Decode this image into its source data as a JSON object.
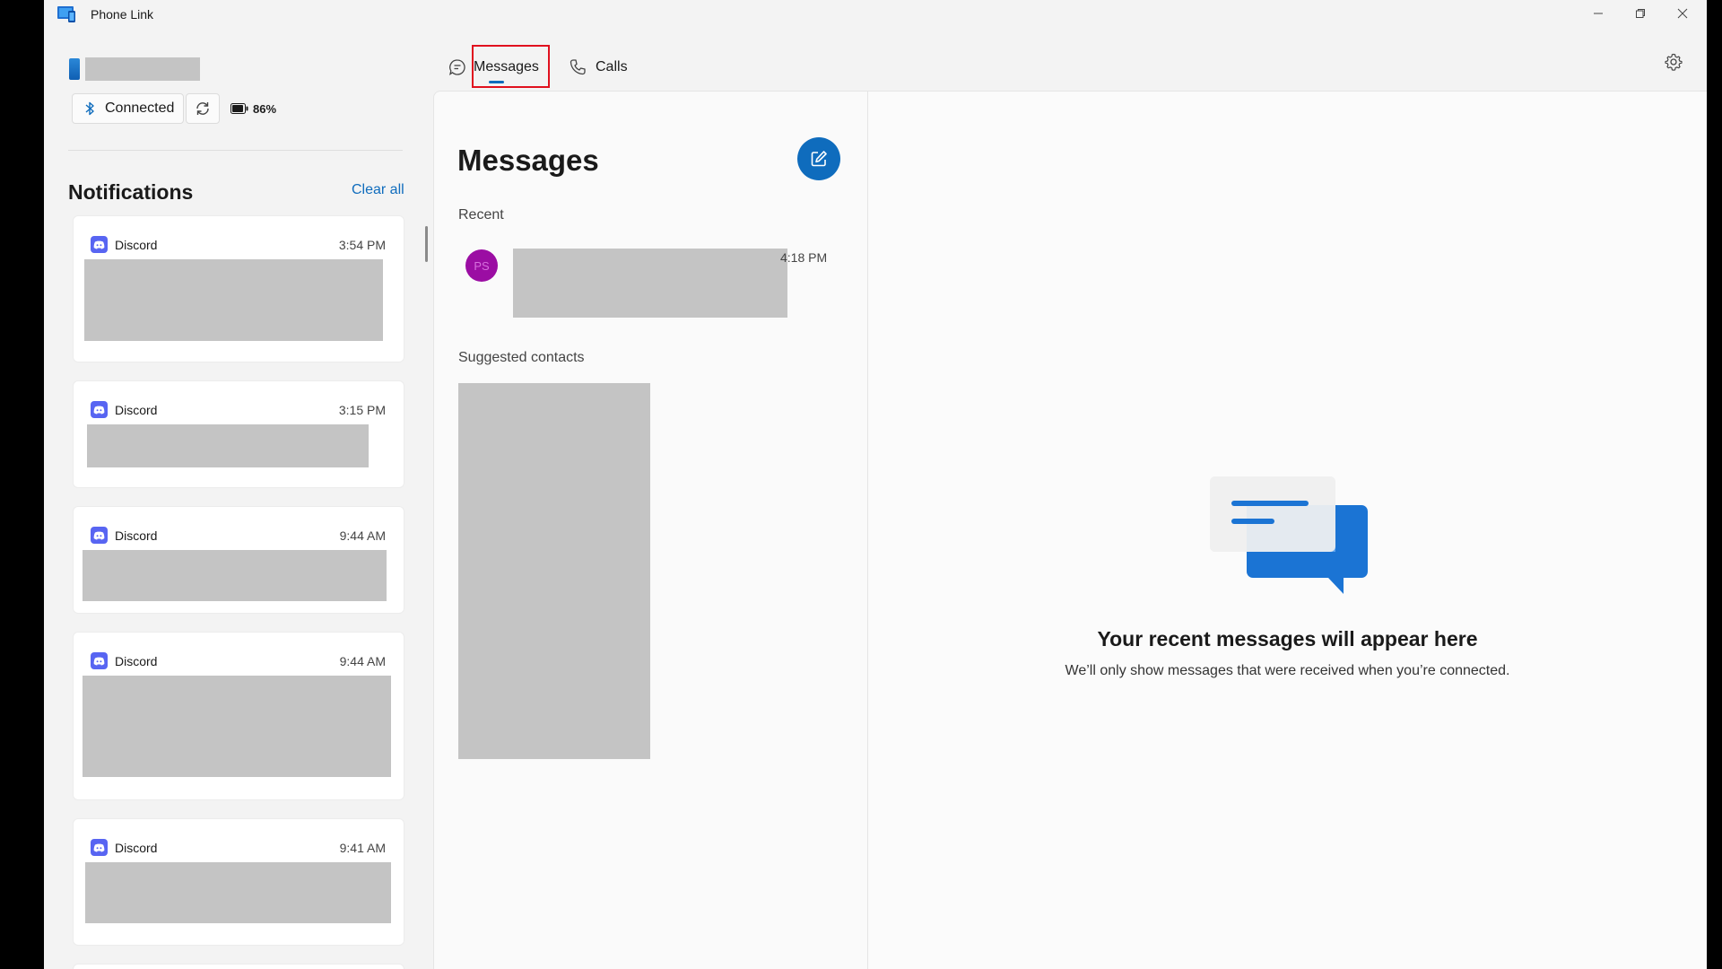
{
  "window": {
    "title": "Phone Link",
    "controls": [
      "minimize",
      "restore",
      "close"
    ]
  },
  "device": {
    "status_label": "Connected",
    "battery_label": "86%"
  },
  "tabs": [
    {
      "label": "Messages",
      "selected": true
    },
    {
      "label": "Calls",
      "selected": false
    }
  ],
  "notifications": {
    "title": "Notifications",
    "clear_all_label": "Clear all",
    "items": [
      {
        "app": "Discord",
        "time": "3:54 PM"
      },
      {
        "app": "Discord",
        "time": "3:15 PM"
      },
      {
        "app": "Discord",
        "time": "9:44 AM"
      },
      {
        "app": "Discord",
        "time": "9:44 AM"
      },
      {
        "app": "Discord",
        "time": "9:41 AM"
      }
    ]
  },
  "messages": {
    "title": "Messages",
    "recent_label": "Recent",
    "recent": [
      {
        "initials": "PS",
        "time": "4:18 PM"
      }
    ],
    "suggested_label": "Suggested contacts"
  },
  "empty_state": {
    "title": "Your recent messages will appear here",
    "subtitle": "We’ll only show messages that were received when you’re connected."
  },
  "colors": {
    "accent": "#0f6cbd",
    "discord": "#5865f2",
    "avatar": "#9b0da3",
    "highlight": "#e0101e"
  }
}
